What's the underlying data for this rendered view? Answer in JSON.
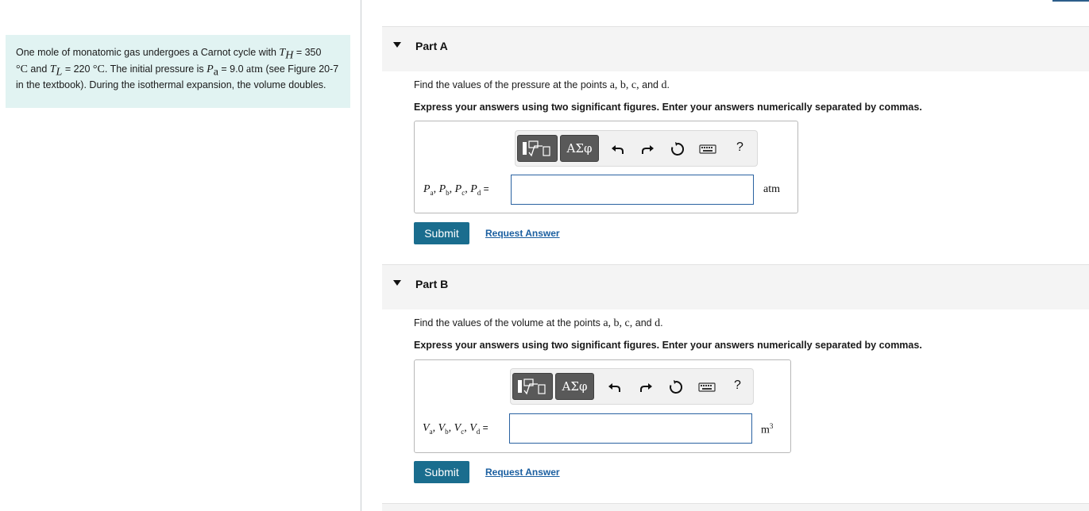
{
  "problem": {
    "seg1": "One mole of monatomic gas undergoes a Carnot cycle with ",
    "th_sym": "T",
    "th_sub": "H",
    "th_val": " = 350",
    "deg1": "°C",
    "seg2": " and ",
    "tl_sym": "T",
    "tl_sub": "L",
    "tl_val": " = 220 ",
    "deg2": "°C",
    "seg3": ". The initial pressure is ",
    "pa_sym": "P",
    "pa_sub": "a",
    "pa_val": " = 9.0 ",
    "pa_unit": "atm",
    "seg4": " (see Figure 20-7 in the textbook). During the isothermal expansion, the volume doubles."
  },
  "partA": {
    "title": "Part A",
    "question_prefix": "Find the values of the pressure at the points ",
    "points": "a, b, c, ",
    "and": "and ",
    "last_point": "d",
    "period": ".",
    "instructions": "Express your answers using two significant figures. Enter your answers numerically separated by commas.",
    "label_vars": [
      "P",
      "a",
      "P",
      "b",
      "P",
      "c",
      "P",
      "d"
    ],
    "label_eq": " =",
    "input_value": "",
    "unit": "atm",
    "submit": "Submit",
    "request": "Request Answer"
  },
  "partB": {
    "title": "Part B",
    "question_prefix": "Find the values of the volume at the points ",
    "points": "a, b, c, ",
    "and": "and ",
    "last_point": "d",
    "period": ".",
    "instructions": "Express your answers using two significant figures. Enter your answers numerically separated by commas.",
    "label_vars": [
      "V",
      "a",
      "V",
      "b",
      "V",
      "c",
      "V",
      "d"
    ],
    "label_eq": " =",
    "input_value": "",
    "unit": "m",
    "unit_sup": "3",
    "submit": "Submit",
    "request": "Request Answer"
  },
  "toolbar": {
    "greek": "ΑΣφ",
    "help": "?",
    "icons": [
      "templates-icon",
      "greek-letters-icon",
      "undo-icon",
      "redo-icon",
      "reset-icon",
      "keyboard-icon",
      "help-icon"
    ]
  }
}
